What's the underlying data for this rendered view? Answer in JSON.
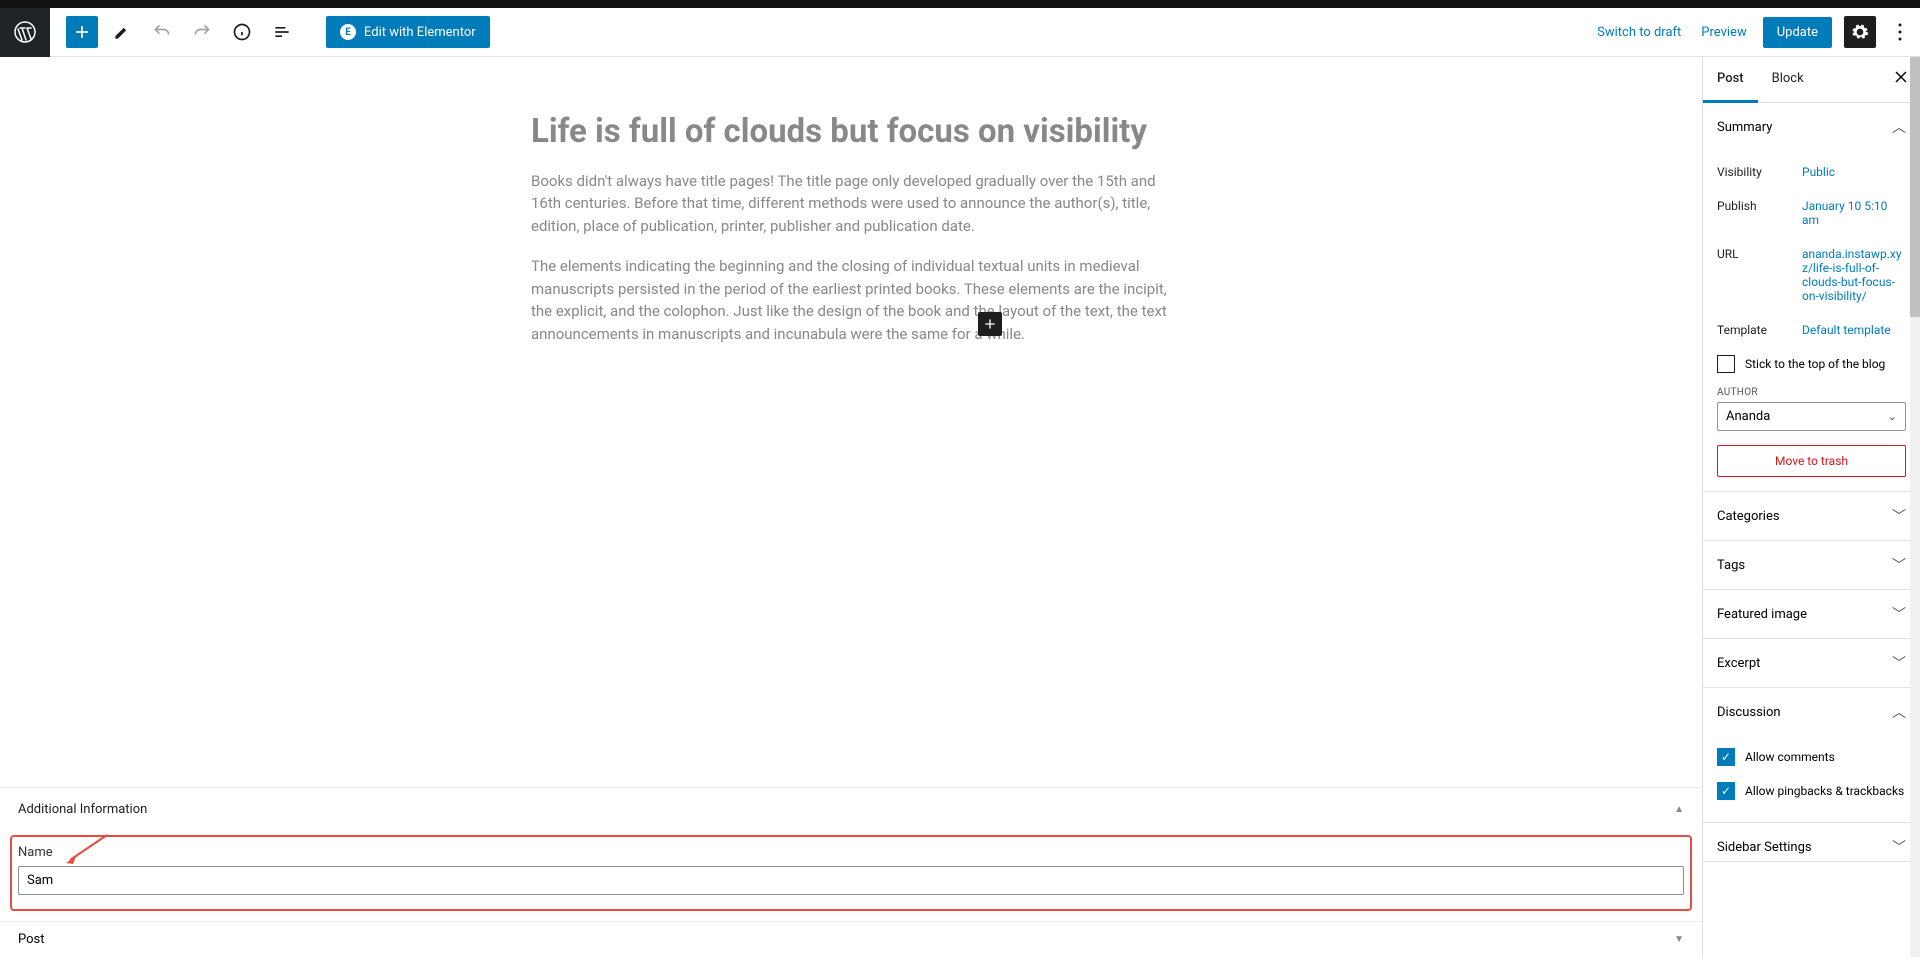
{
  "toolbar": {
    "elementor_label": "Edit with Elementor",
    "switch_draft": "Switch to draft",
    "preview": "Preview",
    "update": "Update"
  },
  "editor": {
    "title": "Life is full of clouds but focus on visibility",
    "para1": "Books didn't always have title pages! The title page only developed gradually over the 15th and 16th centuries. Before that time, different methods were used to announce the author(s), title, edition, place of publication, printer, publisher and publication date.",
    "para2": "The elements indicating the beginning and the closing of individual textual units in medieval manuscripts persisted in the period of the earliest printed books. These elements are the incipit, the explicit, and the colophon. Just like the design of the book and the layout of the text, the text announcements in manuscripts and incunabula were the same for a while."
  },
  "meta": {
    "section_title": "Additional Information",
    "name_label": "Name",
    "name_value": "Sam",
    "footer": "Post"
  },
  "sidebar": {
    "tabs": {
      "post": "Post",
      "block": "Block"
    },
    "panels": {
      "summary": "Summary",
      "categories": "Categories",
      "tags": "Tags",
      "featured": "Featured image",
      "excerpt": "Excerpt",
      "discussion": "Discussion",
      "sidebar_settings": "Sidebar Settings"
    },
    "summary": {
      "visibility_label": "Visibility",
      "visibility_value": "Public",
      "publish_label": "Publish",
      "publish_value": "January 10 5:10 am",
      "url_label": "URL",
      "url_value": "ananda.instawp.xyz/life-is-full-of-clouds-but-focus-on-visibility/",
      "template_label": "Template",
      "template_value": "Default template",
      "stick_label": "Stick to the top of the blog",
      "author_label": "AUTHOR",
      "author_value": "Ananda",
      "trash": "Move to trash"
    },
    "discussion": {
      "comments": "Allow comments",
      "pingbacks": "Allow pingbacks & trackbacks"
    }
  }
}
